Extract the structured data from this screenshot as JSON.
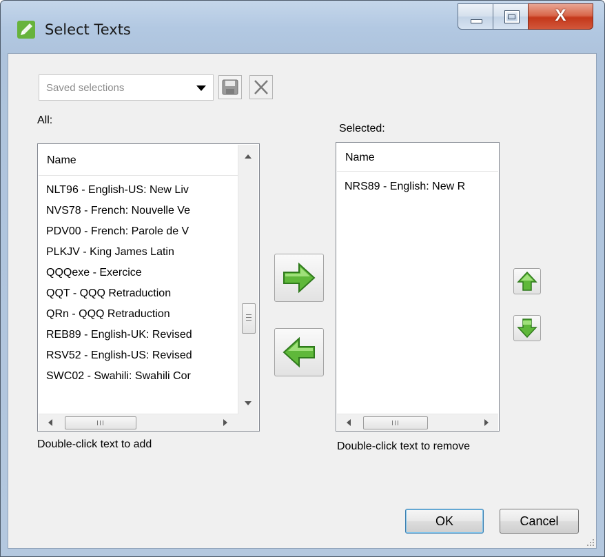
{
  "window": {
    "title": "Select Texts",
    "accent_close": "#c4381b",
    "title_icon": "pencil-icon"
  },
  "toolbar": {
    "saved_selections_placeholder": "Saved selections",
    "save_icon": "save-icon",
    "delete_icon": "delete-x-icon"
  },
  "all_list": {
    "label": "All:",
    "column_header": "Name",
    "items": [
      "NLT96 - English-US: New Liv",
      "NVS78 - French: Nouvelle Ve",
      "PDV00 - French: Parole de V",
      "PLKJV - King James Latin",
      "QQQexe - Exercice",
      "QQT - QQQ Retraduction",
      "QRn - QQQ Retraduction",
      "REB89 - English-UK: Revised",
      "RSV52 - English-US: Revised",
      "SWC02 - Swahili: Swahili Cor"
    ],
    "hint": "Double-click text to add"
  },
  "selected_list": {
    "label": "Selected:",
    "column_header": "Name",
    "items": [
      "NRS89 - English: New R"
    ],
    "hint": "Double-click text to remove"
  },
  "transfer_buttons": {
    "add_icon": "arrow-right-icon",
    "remove_icon": "arrow-left-icon",
    "color": "#5fb83a"
  },
  "order_buttons": {
    "up_icon": "arrow-up-icon",
    "down_icon": "arrow-down-icon"
  },
  "footer": {
    "ok_label": "OK",
    "cancel_label": "Cancel"
  }
}
